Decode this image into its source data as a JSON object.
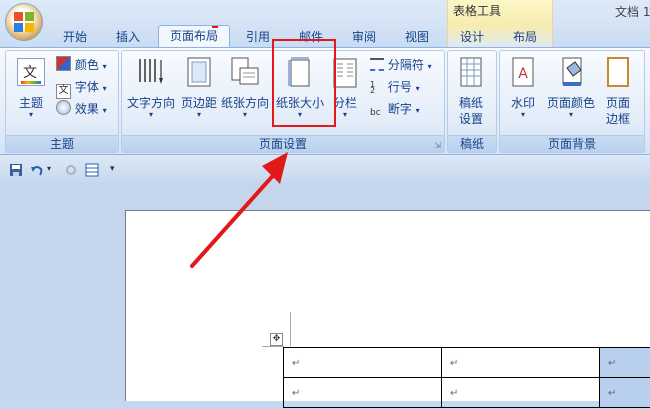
{
  "window": {
    "doc_title": "文档 1",
    "context_tab_group": "表格工具"
  },
  "tabs": [
    {
      "label": "开始",
      "active": false
    },
    {
      "label": "插入",
      "active": false
    },
    {
      "label": "页面布局",
      "active": true
    },
    {
      "label": "引用",
      "active": false
    },
    {
      "label": "邮件",
      "active": false
    },
    {
      "label": "审阅",
      "active": false
    },
    {
      "label": "视图",
      "active": false
    },
    {
      "label": "设计",
      "active": false
    },
    {
      "label": "布局",
      "active": false
    }
  ],
  "ribbon": {
    "theme_group": {
      "label": "主题",
      "theme_button": "主题",
      "colors": "颜色",
      "fonts": "字体",
      "effects": "效果",
      "theme_icon_text": "文"
    },
    "page_setup_group": {
      "label": "页面设置",
      "text_direction": "文字方向",
      "margins": "页边距",
      "orientation": "纸张方向",
      "size": "纸张大小",
      "columns": "分栏",
      "breaks": "分隔符",
      "line_numbers": "行号",
      "hyphenation": "断字"
    },
    "draft_group": {
      "label": "稿纸",
      "draft_settings_line1": "稿纸",
      "draft_settings_line2": "设置"
    },
    "page_background_group": {
      "label": "页面背景",
      "watermark": "水印",
      "page_color": "页面颜色",
      "page_borders_line1": "页面",
      "page_borders_line2": "边框"
    }
  },
  "table": {
    "cell_mark": "↵"
  },
  "colors": {
    "annotation_red": "#e21919",
    "ribbon_text": "#15428b"
  }
}
